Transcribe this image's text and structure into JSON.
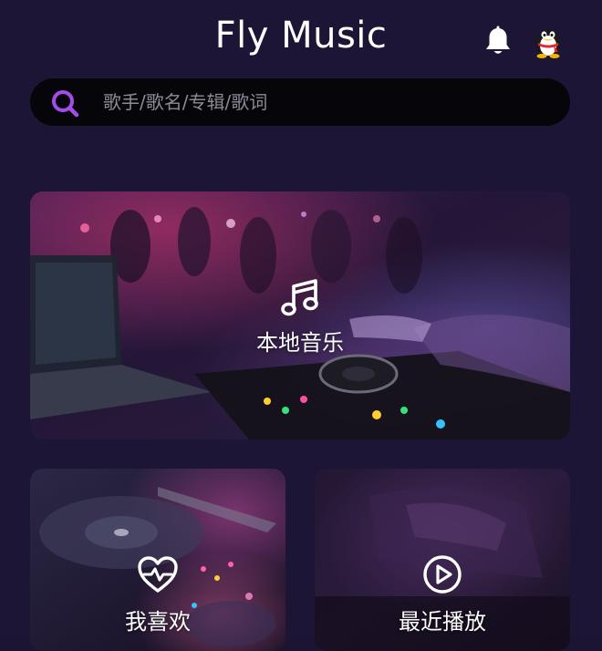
{
  "header": {
    "title": "Fly Music",
    "notification_icon": "bell-icon",
    "avatar_icon": "penguin-avatar-icon"
  },
  "search": {
    "placeholder": "歌手/歌名/专辑/歌词",
    "value": "",
    "icon": "search-icon"
  },
  "cards": {
    "local_music": {
      "label": "本地音乐",
      "icon": "music-note-icon"
    },
    "favorites": {
      "label": "我喜欢",
      "icon": "heart-pulse-icon"
    },
    "recent": {
      "label": "最近播放",
      "icon": "play-circle-icon"
    }
  },
  "colors": {
    "background": "#1c1535",
    "search_bg": "#060509",
    "accent": "#a34de8"
  }
}
